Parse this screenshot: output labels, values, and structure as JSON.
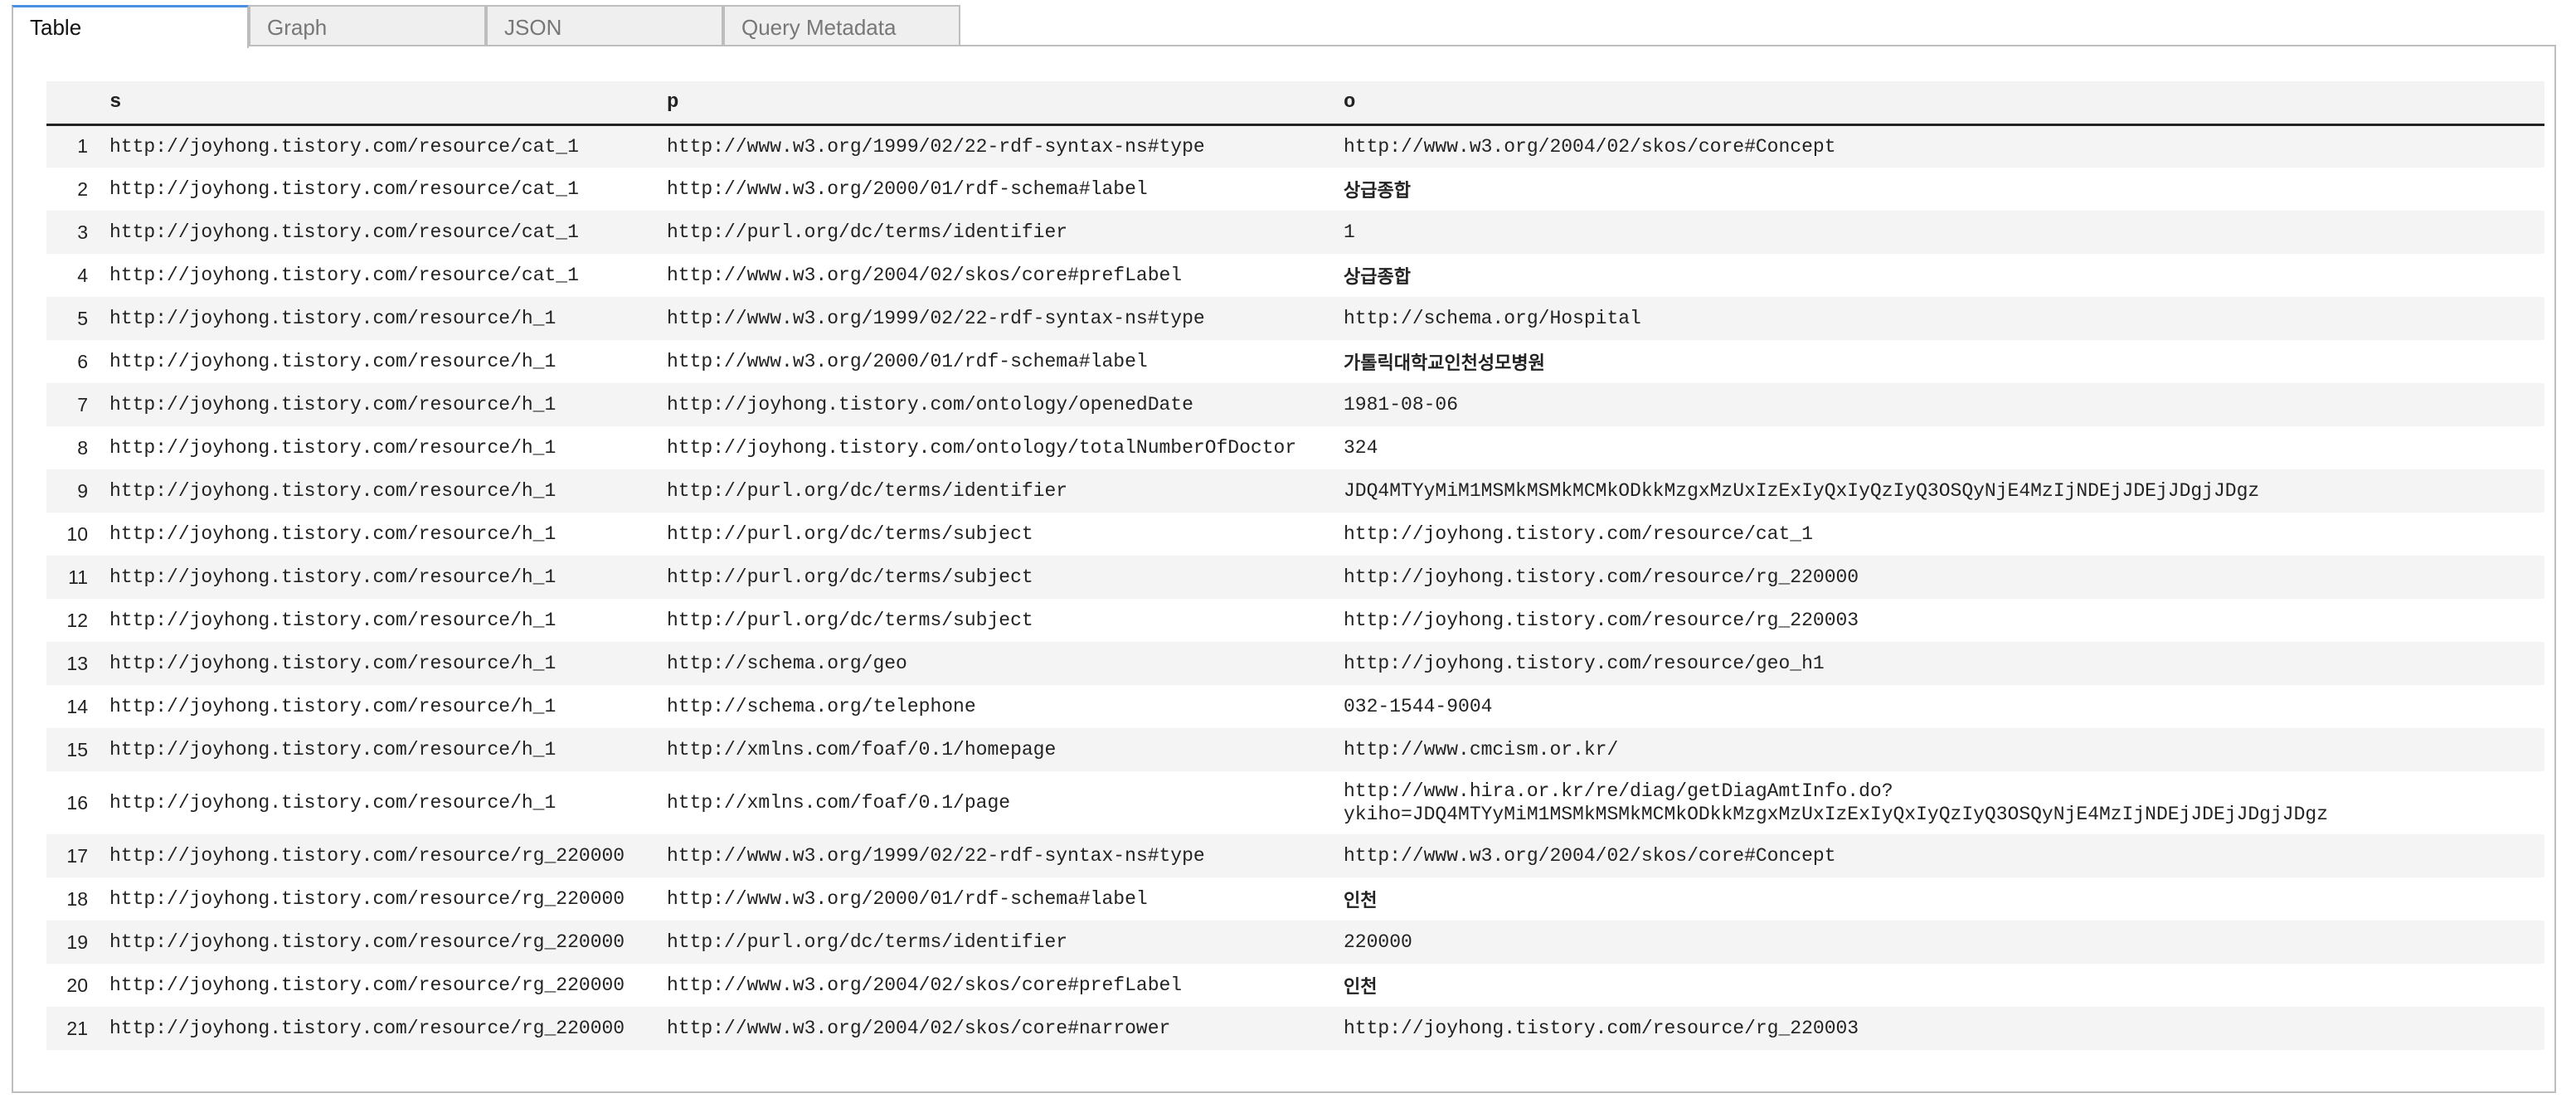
{
  "tabs": [
    {
      "label": "Table",
      "active": true
    },
    {
      "label": "Graph",
      "active": false
    },
    {
      "label": "JSON",
      "active": false
    },
    {
      "label": "Query Metadata",
      "active": false
    }
  ],
  "table": {
    "headers": {
      "idx": "",
      "s": "s",
      "p": "p",
      "o": "o"
    },
    "rows": [
      {
        "n": "1",
        "s": "http://joyhong.tistory.com/resource/cat_1",
        "p": "http://www.w3.org/1999/02/22-rdf-syntax-ns#type",
        "o": "http://www.w3.org/2004/02/skos/core#Concept"
      },
      {
        "n": "2",
        "s": "http://joyhong.tistory.com/resource/cat_1",
        "p": "http://www.w3.org/2000/01/rdf-schema#label",
        "o": "상급종합"
      },
      {
        "n": "3",
        "s": "http://joyhong.tistory.com/resource/cat_1",
        "p": "http://purl.org/dc/terms/identifier",
        "o": "1"
      },
      {
        "n": "4",
        "s": "http://joyhong.tistory.com/resource/cat_1",
        "p": "http://www.w3.org/2004/02/skos/core#prefLabel",
        "o": "상급종합"
      },
      {
        "n": "5",
        "s": "http://joyhong.tistory.com/resource/h_1",
        "p": "http://www.w3.org/1999/02/22-rdf-syntax-ns#type",
        "o": "http://schema.org/Hospital"
      },
      {
        "n": "6",
        "s": "http://joyhong.tistory.com/resource/h_1",
        "p": "http://www.w3.org/2000/01/rdf-schema#label",
        "o": "가톨릭대학교인천성모병원"
      },
      {
        "n": "7",
        "s": "http://joyhong.tistory.com/resource/h_1",
        "p": "http://joyhong.tistory.com/ontology/openedDate",
        "o": "1981-08-06"
      },
      {
        "n": "8",
        "s": "http://joyhong.tistory.com/resource/h_1",
        "p": "http://joyhong.tistory.com/ontology/totalNumberOfDoctor",
        "o": "324"
      },
      {
        "n": "9",
        "s": "http://joyhong.tistory.com/resource/h_1",
        "p": "http://purl.org/dc/terms/identifier",
        "o": "JDQ4MTYyMiM1MSMkMSMkMCMkODkkMzgxMzUxIzExIyQxIyQzIyQ3OSQyNjE4MzIjNDEjJDEjJDgjJDgz"
      },
      {
        "n": "10",
        "s": "http://joyhong.tistory.com/resource/h_1",
        "p": "http://purl.org/dc/terms/subject",
        "o": "http://joyhong.tistory.com/resource/cat_1"
      },
      {
        "n": "11",
        "s": "http://joyhong.tistory.com/resource/h_1",
        "p": "http://purl.org/dc/terms/subject",
        "o": "http://joyhong.tistory.com/resource/rg_220000"
      },
      {
        "n": "12",
        "s": "http://joyhong.tistory.com/resource/h_1",
        "p": "http://purl.org/dc/terms/subject",
        "o": "http://joyhong.tistory.com/resource/rg_220003"
      },
      {
        "n": "13",
        "s": "http://joyhong.tistory.com/resource/h_1",
        "p": "http://schema.org/geo",
        "o": "http://joyhong.tistory.com/resource/geo_h1"
      },
      {
        "n": "14",
        "s": "http://joyhong.tistory.com/resource/h_1",
        "p": "http://schema.org/telephone",
        "o": "032-1544-9004"
      },
      {
        "n": "15",
        "s": "http://joyhong.tistory.com/resource/h_1",
        "p": "http://xmlns.com/foaf/0.1/homepage",
        "o": "http://www.cmcism.or.kr/"
      },
      {
        "n": "16",
        "s": "http://joyhong.tistory.com/resource/h_1",
        "p": "http://xmlns.com/foaf/0.1/page",
        "o": "http://www.hira.or.kr/re/diag/getDiagAmtInfo.do?",
        "o2": "ykiho=JDQ4MTYyMiM1MSMkMSMkMCMkODkkMzgxMzUxIzExIyQxIyQzIyQ3OSQyNjE4MzIjNDEjJDEjJDgjJDgz"
      },
      {
        "n": "17",
        "s": "http://joyhong.tistory.com/resource/rg_220000",
        "p": "http://www.w3.org/1999/02/22-rdf-syntax-ns#type",
        "o": "http://www.w3.org/2004/02/skos/core#Concept"
      },
      {
        "n": "18",
        "s": "http://joyhong.tistory.com/resource/rg_220000",
        "p": "http://www.w3.org/2000/01/rdf-schema#label",
        "o": "인천"
      },
      {
        "n": "19",
        "s": "http://joyhong.tistory.com/resource/rg_220000",
        "p": "http://purl.org/dc/terms/identifier",
        "o": "220000"
      },
      {
        "n": "20",
        "s": "http://joyhong.tistory.com/resource/rg_220000",
        "p": "http://www.w3.org/2004/02/skos/core#prefLabel",
        "o": "인천"
      },
      {
        "n": "21",
        "s": "http://joyhong.tistory.com/resource/rg_220000",
        "p": "http://www.w3.org/2004/02/skos/core#narrower",
        "o": "http://joyhong.tistory.com/resource/rg_220003"
      }
    ]
  }
}
